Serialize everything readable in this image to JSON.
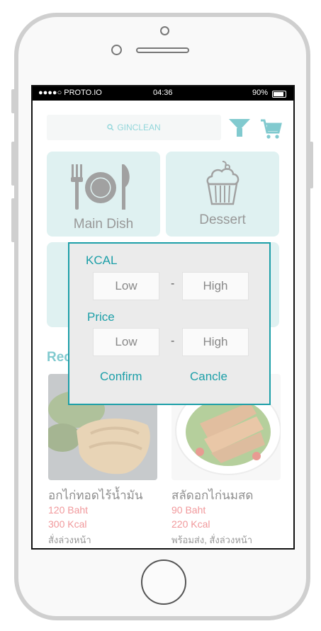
{
  "status_bar": {
    "carrier": "●●●●○ PROTO.IO",
    "time": "04:36",
    "battery": "90%"
  },
  "search": {
    "placeholder": "GINCLEAN",
    "icon": "search-icon"
  },
  "header_icons": {
    "filter": "filter-icon",
    "cart": "cart-icon"
  },
  "categories": [
    {
      "label": "Main Dish",
      "icon": "plate-cutlery-icon"
    },
    {
      "label": "Dessert",
      "icon": "cupcake-icon"
    }
  ],
  "recommend": {
    "title": "Rec",
    "items": [
      {
        "name": "อกไก่ทอดไร้น้ำมัน",
        "price": "120 Baht",
        "kcal": "300 Kcal",
        "status": "สั่งล่วงหน้า"
      },
      {
        "name": "สลัดอกไก่นมสด",
        "price": "90 Baht",
        "kcal": "220 Kcal",
        "status": "พร้อมส่ง, สั่งล่วงหน้า"
      }
    ]
  },
  "filter_modal": {
    "kcal_label": "KCAL",
    "price_label": "Price",
    "low_placeholder": "Low",
    "high_placeholder": "High",
    "separator": "-",
    "confirm_label": "Confirm",
    "cancel_label": "Cancle"
  },
  "colors": {
    "accent": "#1c9fa8",
    "card_bg": "#c6e7e6",
    "price_red": "#e6454b"
  }
}
